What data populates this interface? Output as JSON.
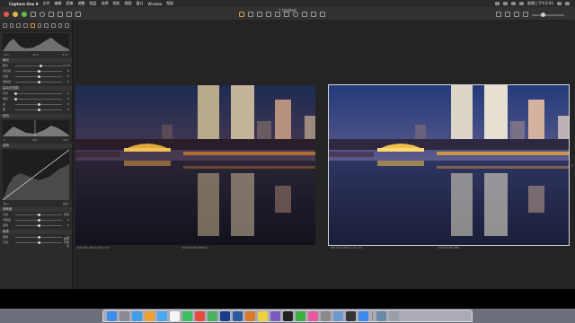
{
  "menubar": {
    "app_name": "Capture One 9",
    "items": [
      "文件",
      "编辑",
      "图像",
      "调整",
      "图层",
      "选择",
      "相机",
      "视图",
      "窗口",
      "Window",
      "帮助"
    ],
    "clock": "星期三下午3:41"
  },
  "toolbar": {
    "title": "* Untitled"
  },
  "histogram": {
    "values": [
      "250",
      "96.4",
      "8.45"
    ]
  },
  "panels": {
    "exposure": "曝光",
    "exposure_sliders": [
      {
        "label": "曝光",
        "value": "+0.33",
        "pos": 0.55
      },
      {
        "label": "对比度",
        "value": "0",
        "pos": 0.5
      },
      {
        "label": "亮度",
        "value": "0",
        "pos": 0.5
      },
      {
        "label": "饱和度",
        "value": "0",
        "pos": 0.5
      }
    ],
    "hdr": "高动态范围",
    "hdr_sliders": [
      {
        "label": "高光",
        "value": "0",
        "pos": 0.0
      },
      {
        "label": "阴影",
        "value": "0",
        "pos": 0.0
      },
      {
        "label": "白",
        "value": "0",
        "pos": 0.5
      },
      {
        "label": "黑",
        "value": "0",
        "pos": 0.5
      }
    ],
    "levels": "色阶",
    "levels_values": [
      "0",
      "128",
      "255"
    ],
    "curve": "曲线",
    "curve_readout": [
      "输入",
      "输出"
    ],
    "clarity": "清晰度",
    "clarity_sliders": [
      {
        "label": "方法",
        "value": "自然",
        "pos": 0.5
      },
      {
        "label": "清晰度",
        "value": "0",
        "pos": 0.5
      },
      {
        "label": "结构",
        "value": "0",
        "pos": 0.5
      }
    ],
    "vignette": "暗角",
    "vignette_sliders": [
      {
        "label": "数量",
        "value": "0",
        "pos": 0.5
      },
      {
        "label": "方法",
        "value": "椭圆形裁切",
        "pos": 0.5
      }
    ]
  },
  "viewer": {
    "left_caption_info": "ISO 200  28mm  f/11  1/4",
    "left_caption_file": "DSC07738.ARW (1)",
    "right_caption_info": "ISO 200  28mm  f/11  1/4",
    "right_caption_file": "DSC07738.ARW"
  },
  "dock": {
    "apps": [
      "finder",
      "launchpad",
      "safari",
      "photos",
      "mail",
      "calendar",
      "messages",
      "chrome",
      "maps",
      "photoshop",
      "lightroom",
      "capture-one",
      "notes",
      "games",
      "qq",
      "wechat",
      "itunes",
      "settings",
      "preview",
      "terminal",
      "app-store",
      "downloads",
      "trash"
    ]
  },
  "colors": {
    "accent": "#d89a2a",
    "sidebar": "#2b2b2b",
    "viewer": "#242424"
  }
}
